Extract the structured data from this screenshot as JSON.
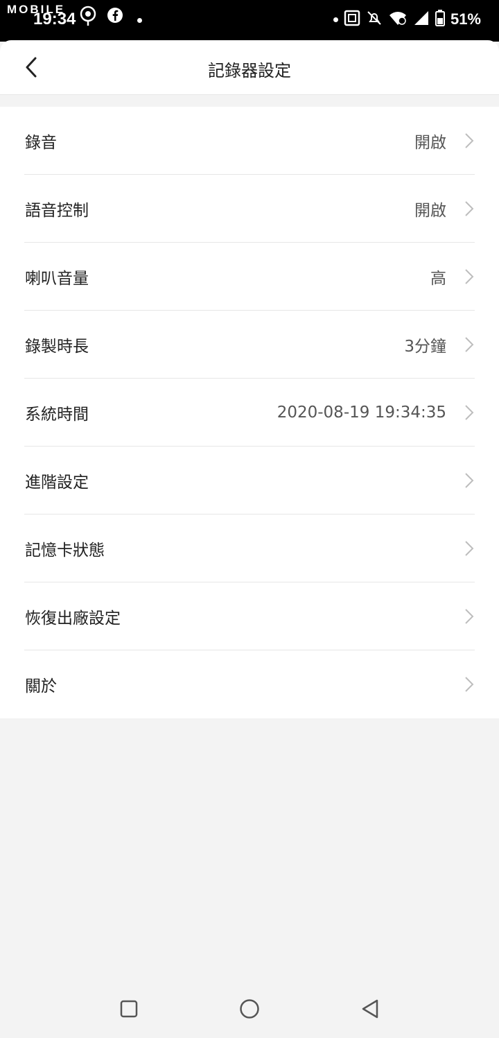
{
  "status_bar": {
    "watermark": "MOBILE",
    "time": "19:34",
    "battery": "51%"
  },
  "header": {
    "title": "記錄器設定"
  },
  "settings": [
    {
      "label": "錄音",
      "value": "開啟"
    },
    {
      "label": "語音控制",
      "value": "開啟"
    },
    {
      "label": "喇叭音量",
      "value": "高"
    },
    {
      "label": "錄製時長",
      "value": "3分鐘"
    },
    {
      "label": "系統時間",
      "value": "2020-08-19 19:34:35"
    },
    {
      "label": "進階設定",
      "value": ""
    },
    {
      "label": "記憶卡狀態",
      "value": ""
    },
    {
      "label": "恢復出廠設定",
      "value": ""
    },
    {
      "label": "關於",
      "value": ""
    }
  ],
  "icons": {
    "back": "chevron-left-icon",
    "row_chevron": "chevron-right-icon",
    "nav_recent": "square-icon",
    "nav_home": "circle-icon",
    "nav_back": "triangle-left-icon"
  },
  "colors": {
    "background": "#f3f3f3",
    "card": "#ffffff",
    "divider": "#e6e6e6",
    "chevron": "#bdbdbd"
  }
}
